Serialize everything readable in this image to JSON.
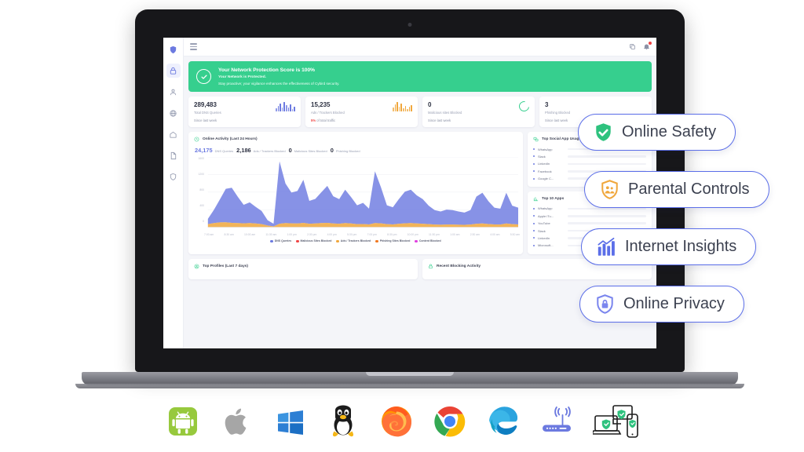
{
  "app": {
    "sidebar": {
      "logo_icon": "shield-logo-icon",
      "items": [
        {
          "icon": "dashboard-lock-icon",
          "name": "dashboard",
          "active": true
        },
        {
          "icon": "person-icon",
          "name": "profiles",
          "active": false
        },
        {
          "icon": "globe-icon",
          "name": "network",
          "active": false
        },
        {
          "icon": "home-icon",
          "name": "devices",
          "active": false
        },
        {
          "icon": "document-icon",
          "name": "reports",
          "active": false
        },
        {
          "icon": "shield-icon",
          "name": "security",
          "active": false
        }
      ]
    },
    "topbar": {
      "menu_icon": "hamburger-menu-icon",
      "copy_icon": "copy-icon",
      "notification_icon": "notification-bell-icon",
      "has_badge": true
    },
    "banner": {
      "icon": "check-circle-icon",
      "title": "Your Network Protection Score is 100%",
      "subtitle": "Your Network is Protected.",
      "note": "Stay proactive; your vigilance enhances the effectiveness of Cybird security.",
      "color": "#36cf8e"
    },
    "stats": [
      {
        "value": "289,483",
        "label": "Total DNS Queries",
        "footer": "Since last week",
        "footer_pct": "",
        "visual": "sparkline-blue"
      },
      {
        "value": "15,235",
        "label": "Ads / Trackers Blocked",
        "footer": "of total traffic",
        "footer_pct": "5%",
        "visual": "sparkline-orange"
      },
      {
        "value": "0",
        "label": "Malicious sites Blocked",
        "footer": "Since last week",
        "footer_pct": "",
        "visual": "ring-green"
      },
      {
        "value": "3",
        "label": "Phishing Blocked",
        "footer": "Since last week",
        "footer_pct": "",
        "visual": "sparkline-blue"
      }
    ],
    "activity": {
      "icon": "clock-icon",
      "title": "Online Activity (Last 24 Hours)",
      "kpis": [
        {
          "value": "24,175",
          "label": "DNS Queries",
          "style": "blue"
        },
        {
          "value": "2,186",
          "label": "Ads / Trackers Blocked",
          "style": "dark"
        },
        {
          "value": "0",
          "label": "Malicious Sites Blocked",
          "style": "dark"
        },
        {
          "value": "0",
          "label": "Phishing Blocked",
          "style": "dark"
        }
      ]
    },
    "social_panel": {
      "icon": "social-apps-icon",
      "title": "Top Social App Usage",
      "rows": [
        {
          "name": "WhatsApp",
          "pct": 96
        },
        {
          "name": "Slack",
          "pct": 42
        },
        {
          "name": "LinkedIn",
          "pct": 38
        },
        {
          "name": "Facebook",
          "pct": 30
        },
        {
          "name": "Google C...",
          "pct": 16
        }
      ]
    },
    "apps_panel": {
      "icon": "bar-chart-icon",
      "title": "Top 10 Apps",
      "rows": [
        {
          "name": "WhatsApp",
          "pct": 96
        },
        {
          "name": "Apple iTu...",
          "pct": 74
        },
        {
          "name": "YouTube",
          "pct": 50
        },
        {
          "name": "Slack",
          "pct": 44
        },
        {
          "name": "LinkedIn",
          "pct": 36
        },
        {
          "name": "Microsoft...",
          "pct": 30
        }
      ]
    },
    "bottom_panels": [
      {
        "icon": "profiles-icon",
        "title": "Top Profiles (Last 7 days)"
      },
      {
        "icon": "lock-icon",
        "title": "Recent Blocking Activity"
      }
    ]
  },
  "chart_data": {
    "type": "area",
    "title": "Online Activity (Last 24 Hours)",
    "xlabel": "",
    "ylabel": "",
    "ylim": [
      0,
      1600
    ],
    "yticks": [
      1600,
      1200,
      800,
      400,
      0
    ],
    "grid": true,
    "legend_position": "bottom",
    "stacked": true,
    "categories": [
      "7:00 am",
      "8:30 am",
      "10:00 am",
      "11:30 am",
      "1:00 pm",
      "2:30 pm",
      "4:00 pm",
      "5:30 pm",
      "7:00 pm",
      "8:30 pm",
      "10:00 pm",
      "11:30 pm",
      "1:00 am",
      "2:30 am",
      "4:00 am",
      "5:30 am"
    ],
    "series": [
      {
        "name": "DNS Queries",
        "color": "#6c7ae0",
        "values": [
          120,
          300,
          520,
          760,
          800,
          600,
          420,
          470,
          380,
          300,
          120,
          60,
          1420,
          900,
          700,
          740,
          980,
          520,
          560,
          700,
          840,
          620,
          560,
          760,
          600,
          430,
          480,
          360,
          1180,
          820,
          430,
          390,
          560,
          720,
          760,
          640,
          560,
          420,
          330,
          300,
          340,
          330,
          300,
          280,
          330,
          620,
          700,
          520,
          380,
          360,
          700,
          420,
          380
        ]
      },
      {
        "name": "Malicious Sites Blocked",
        "color": "#ef4444",
        "values": [
          0,
          0,
          0,
          0,
          0,
          0,
          0,
          0,
          0,
          0,
          0,
          0,
          0,
          0,
          0,
          0
        ]
      },
      {
        "name": "Ads / Trackers Blocked",
        "color": "#f0a73c",
        "values": [
          70,
          95,
          110,
          115,
          100,
          95,
          90,
          95,
          85,
          70,
          40,
          20,
          80,
          95,
          90,
          85,
          100,
          80,
          85,
          95,
          100,
          85,
          80,
          95,
          85,
          70,
          75,
          65,
          95,
          90,
          70,
          65,
          80,
          90,
          95,
          85,
          80,
          70,
          60,
          58,
          62,
          60,
          58,
          55,
          60,
          80,
          85,
          75,
          65,
          62,
          85,
          70,
          65
        ]
      },
      {
        "name": "Phishing Sites Blocked",
        "color": "#f07820",
        "values": [
          0,
          0,
          0,
          0,
          0,
          0,
          0,
          0,
          0,
          0,
          0,
          0,
          0,
          0,
          0,
          0
        ]
      },
      {
        "name": "Content Blocked",
        "color": "#e040e0",
        "values": [
          0,
          0,
          0,
          0,
          0,
          0,
          0,
          0,
          0,
          0,
          0,
          0,
          0,
          0,
          0,
          0
        ]
      }
    ]
  },
  "callouts": [
    {
      "label": "Online Safety",
      "icon": "shield-check-icon",
      "color": "#2ec27e"
    },
    {
      "label": "Parental Controls",
      "icon": "shield-family-icon",
      "color": "#f0a73c"
    },
    {
      "label": "Internet Insights",
      "icon": "bar-chart-icon",
      "color": "#5b6ee8"
    },
    {
      "label": "Online Privacy",
      "icon": "shield-lock-icon",
      "color": "#7b86ee"
    }
  ],
  "platforms": [
    {
      "name": "android-icon",
      "label": "Android"
    },
    {
      "name": "apple-icon",
      "label": "Apple"
    },
    {
      "name": "windows-icon",
      "label": "Windows"
    },
    {
      "name": "linux-tux-icon",
      "label": "Linux"
    },
    {
      "name": "firefox-icon",
      "label": "Firefox"
    },
    {
      "name": "chrome-icon",
      "label": "Chrome"
    },
    {
      "name": "edge-icon",
      "label": "Edge"
    },
    {
      "name": "router-icon",
      "label": "Router"
    },
    {
      "name": "multi-device-icon",
      "label": "Devices"
    }
  ]
}
